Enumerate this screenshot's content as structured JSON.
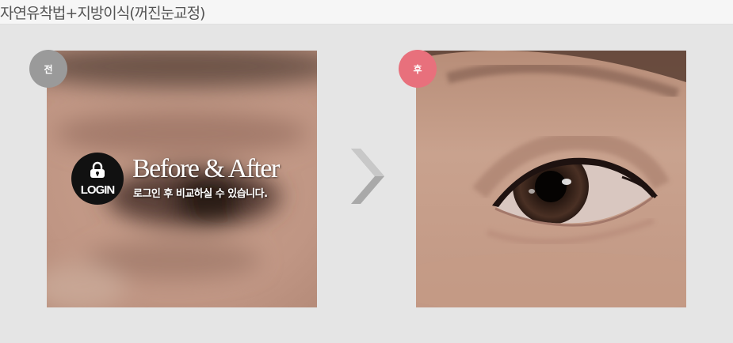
{
  "title": "자연유착법+지방이식(꺼진눈교정)",
  "before": {
    "badge": "전",
    "login_overlay": {
      "icon": "lock-icon",
      "login_label": "LOGIN",
      "heading": "Before & After",
      "subtext": "로그인 후 비교하실 수 있습니다."
    }
  },
  "after": {
    "badge": "후"
  },
  "arrow_icon": "chevron-right-icon",
  "colors": {
    "before_badge": "#9a9a9a",
    "after_badge": "#e8707c",
    "background": "#e5e5e5"
  }
}
